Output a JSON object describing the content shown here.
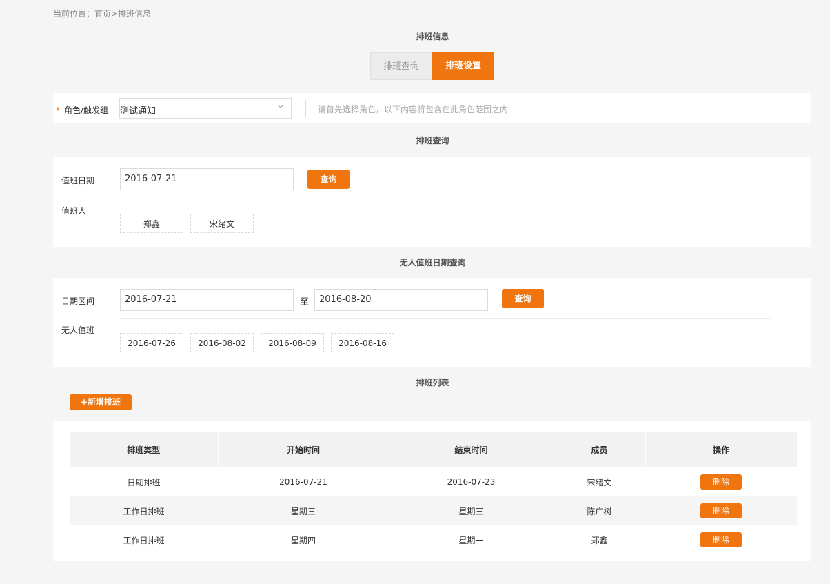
{
  "breadcrumb": "当前位置：首页>排班信息",
  "sections": {
    "info": "排班信息",
    "query": "排班查询",
    "no_duty": "无人值班日期查询",
    "list": "排班列表"
  },
  "tabs": [
    {
      "label": "排班查询",
      "active": false
    },
    {
      "label": "排班设置",
      "active": true
    }
  ],
  "role": {
    "required_mark": "*",
    "label": "角色/触发组",
    "value": "测试通知",
    "hint": "请首先选择角色，以下内容将包含在此角色范围之内"
  },
  "duty_query": {
    "date_label": "值班日期",
    "date_value": "2016-07-21",
    "button": "查询",
    "person_label": "值班人",
    "persons": [
      "郑鑫",
      "宋绪文"
    ]
  },
  "no_duty_query": {
    "range_label": "日期区间",
    "start": "2016-07-21",
    "to": "至",
    "end": "2016-08-20",
    "button": "查询",
    "result_label": "无人值班",
    "dates": [
      "2016-07-26",
      "2016-08-02",
      "2016-08-09",
      "2016-08-16"
    ]
  },
  "add_button": "+新增排班",
  "table": {
    "headers": [
      "排班类型",
      "开始时间",
      "结束时间",
      "成员",
      "操作"
    ],
    "rows": [
      {
        "type": "日期排班",
        "start": "2016-07-21",
        "end": "2016-07-23",
        "member": "宋绪文",
        "action": "删除"
      },
      {
        "type": "工作日排班",
        "start": "星期三",
        "end": "星期三",
        "member": "陈广树",
        "action": "删除"
      },
      {
        "type": "工作日排班",
        "start": "星期四",
        "end": "星期一",
        "member": "郑鑫",
        "action": "删除"
      }
    ]
  },
  "colors": {
    "accent": "#f0750f",
    "background": "#f5f5f5"
  },
  "icons": {
    "select_arrow": "chevron-down-icon"
  }
}
